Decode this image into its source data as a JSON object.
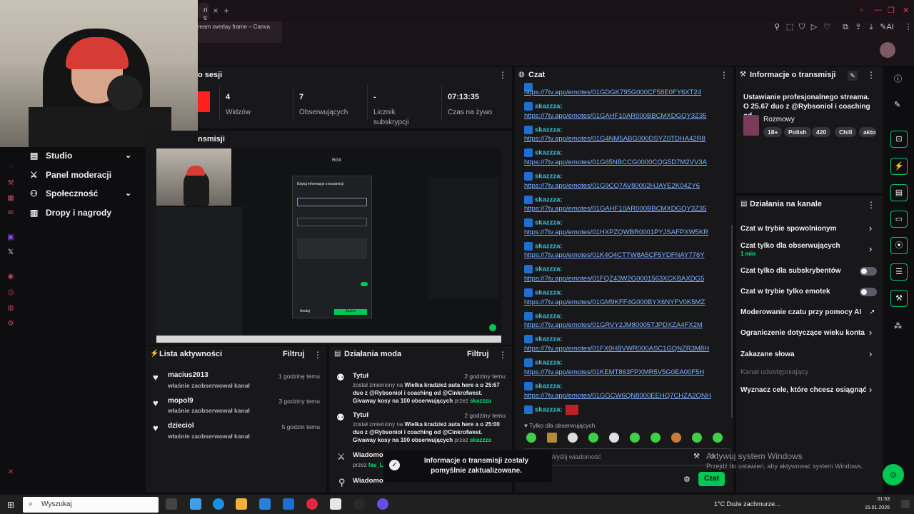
{
  "browser": {
    "tab_partial": "ri s",
    "tab_close": "×",
    "new_tab": "+",
    "toolbar_title": "ream overlay frame – Canva",
    "ai_label": "AI"
  },
  "left_nav": {
    "items": [
      {
        "label": "Studio"
      },
      {
        "label": "Panel moderacji"
      },
      {
        "label": "Społeczność"
      },
      {
        "label": "Dropy i nagrody"
      }
    ]
  },
  "session": {
    "title": "o sesji",
    "stats": [
      {
        "value": "4",
        "label": "Widzów"
      },
      {
        "value": "7",
        "label": "Obserwujących"
      },
      {
        "value": "-",
        "label": "Licznik subskrypcji"
      },
      {
        "value": "07:13:35",
        "label": "Czas na żywo"
      }
    ]
  },
  "preview": {
    "title": "nsmisji",
    "dialog_title": "Edytuj informacje o transmisji",
    "cancel": "Anuluj",
    "save": "Zapisz",
    "corner_label": "RGX"
  },
  "chat": {
    "title": "Czat",
    "messages": [
      {
        "user": "",
        "link": "https://7tv.app/emotes/01GDGK795G000CF58E0FY6XT24"
      },
      {
        "user": "skazzza:",
        "link": "https://7tv.app/emotes/01GAHF10AR000BBCMXDGQY3Z35"
      },
      {
        "user": "skazzza:",
        "link": "https://7tv.app/emotes/01G4NM5ABG000DSYZ0TDHA42R8"
      },
      {
        "user": "skazzza:",
        "link": "https://7tv.app/emotes/01G65NBCCG0000CQG5D7M2VV3A"
      },
      {
        "user": "skazzza:",
        "link": "https://7tv.app/emotes/01G9CQ7AV80002HJAYE2K04ZY6"
      },
      {
        "user": "skazzza:",
        "link": "https://7tv.app/emotes/01GAHF10AR000BBCMXDGQY3Z35"
      },
      {
        "user": "skazzza:",
        "link": "https://7tv.app/emotes/01HXPZQWBR0001PYJSAFPXW5KR"
      },
      {
        "user": "skazzza:",
        "link": "https://7tv.app/emotes/01K4Q4CTTW8A5CF5YDFNAY776Y"
      },
      {
        "user": "skazzza:",
        "link": "https://7tv.app/emotes/01FQZ43W2G0001563XCKBAXDG5"
      },
      {
        "user": "skazzza:",
        "link": "https://7tv.app/emotes/01GM9KFF4G000BYX6NYFV0K5MZ"
      },
      {
        "user": "skazzza:",
        "link": "https://7tv.app/emotes/01GRVY2JM80005TJPDXZA4FX2M"
      },
      {
        "user": "skazzza:",
        "link": "https://7tv.app/emotes/01FX0HBVWR000ASC1GQNZR3M8H"
      },
      {
        "user": "skazzza:",
        "link": "https://7tv.app/emotes/01KEMT863FPXMR5V5G0EA00F5H"
      },
      {
        "user": "skazzza:",
        "link": "https://7tv.app/emotes/01GGCW6QN8000EEHQ7CHZA2QNH"
      }
    ],
    "last_user": "skazzza:",
    "followers_only": "Tylko dla obserwujących",
    "input_placeholder": "Wyślij wiadomość",
    "send_button": "Czat",
    "colors": {
      "username": "#2fc8d8",
      "link": "#7fb3ff",
      "send": "#00c853"
    }
  },
  "stream_info": {
    "title": "Informacje o transmisji",
    "stream_title": "Ustawianie profesjonalnego streama. O 25.67 duo z @Rybsoniol i coaching od...",
    "category": "Rozmowy",
    "tags": [
      "18+",
      "Polish",
      "420",
      "Chill",
      "akto"
    ]
  },
  "channel_actions": {
    "title": "Działania na kanale",
    "items": [
      {
        "label": "Czat w trybie spowolnionym",
        "sub": ""
      },
      {
        "label": "Czat tylko dla obserwujących",
        "sub": "1 min"
      },
      {
        "label": "Czat tylko dla subskrybentów",
        "sub": ""
      },
      {
        "label": "Czat w trybie tylko emotek",
        "sub": ""
      },
      {
        "label": "Moderowanie czatu przy pomocy AI",
        "sub": ""
      },
      {
        "label": "Ograniczenie dotyczące wieku konta",
        "sub": ""
      },
      {
        "label": "Zakazane słowa",
        "sub": ""
      },
      {
        "label": "Kanał udostępniający",
        "sub": ""
      },
      {
        "label": "Wyznacz cele, które chcesz osiągnąć",
        "sub": ""
      }
    ]
  },
  "activity": {
    "title": "Lista aktywności",
    "filter": "Filtruj",
    "items": [
      {
        "name": "macius2013",
        "sub": "właśnie zaobserwował kanał",
        "time": "1 godzinę temu"
      },
      {
        "name": "mopol9",
        "sub": "właśnie zaobserwował kanał",
        "time": "3 godziny temu"
      },
      {
        "name": "dzieciol",
        "sub": "właśnie zaobserwował kanał",
        "time": "5 godzin temu"
      }
    ]
  },
  "mod_actions": {
    "title": "Działania moda",
    "filter": "Filtruj",
    "items": [
      {
        "title": "Tytuł",
        "time": "2 godziny temu",
        "pre": "został zmieniony na",
        "text": "Wielka kradzież auta here a o 25:67 duo z @Rybsoniol i coaching od @Cinkrofwest. Givaway kosy na 100 obserwujących",
        "by": "przez",
        "user": "skazzza"
      },
      {
        "title": "Tytuł",
        "time": "2 godziny temu",
        "pre": "został zmieniony na",
        "text": "Wielka kradzież auta here a o 25:00 duo z @Rybsoniol i coaching od @Cinkrofwest. Givaway kosy na 100 obserwujących",
        "by": "przez",
        "user": "skazzza"
      },
      {
        "title": "Wiadomo",
        "time": "",
        "pre": "",
        "text": "",
        "by": "przez",
        "user": "fav_L"
      },
      {
        "title": "Wiadomo",
        "time": "",
        "pre": "",
        "text": "",
        "by": "",
        "user": ""
      }
    ]
  },
  "toast": {
    "message": "Informacje o transmisji zostały pomyślnie zaktualizowane."
  },
  "windows": {
    "activate_title": "Aktywuj system Windows",
    "activate_sub": "Przejdź do ustawień, aby aktywować system Windows.",
    "search": "Wyszukaj",
    "weather": "1°C  Duże zachmurze...",
    "time": "01:53",
    "date": "15.01.2026"
  }
}
